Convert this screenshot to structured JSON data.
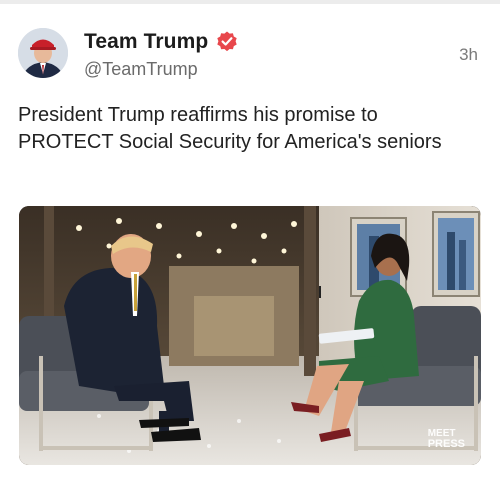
{
  "post": {
    "author_name": "Team Trump",
    "handle": "@TeamTrump",
    "time_ago": "3h",
    "text": "President Trump reaffirms his promise to PROTECT Social Security for America's seniors",
    "verified": true,
    "badge_color": "#e8474c"
  },
  "media": {
    "watermark_line1": "MEET",
    "watermark_line2": "PRESS"
  }
}
